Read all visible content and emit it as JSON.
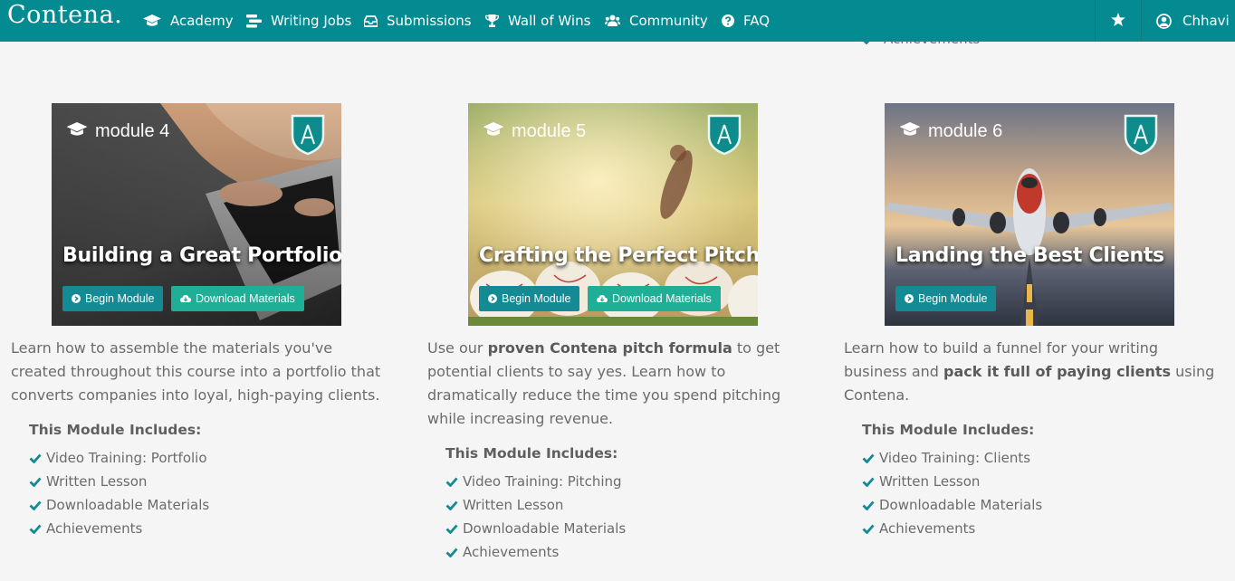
{
  "brand": "Contena.",
  "nav": {
    "items": [
      {
        "label": "Academy",
        "icon": "graduation-cap-icon"
      },
      {
        "label": "Writing Jobs",
        "icon": "jobs-icon"
      },
      {
        "label": "Submissions",
        "icon": "inbox-icon"
      },
      {
        "label": "Wall of Wins",
        "icon": "trophy-icon"
      },
      {
        "label": "Community",
        "icon": "users-icon"
      },
      {
        "label": "FAQ",
        "icon": "question-circle-icon"
      }
    ],
    "user": "Chhavi"
  },
  "peek_item": "Achievements",
  "colors": {
    "nav": "#048a91",
    "begin_button": "#138a94",
    "download_button": "#1fae96",
    "check": "#138a94"
  },
  "modules": [
    {
      "label": "module 4",
      "title": "Building a Great Portfolio",
      "begin": "Begin Module",
      "download": "Download Materials",
      "desc": [
        {
          "t": "Learn how to assemble the materials you've created throughout this course into a portfolio that converts companies into loyal, high-paying clients.",
          "b": false
        }
      ],
      "includes_title": "This Module Includes:",
      "includes": [
        "Video Training: Portfolio",
        "Written Lesson",
        "Downloadable Materials",
        "Achievements"
      ]
    },
    {
      "label": "module 5",
      "title": "Crafting the Perfect Pitch",
      "begin": "Begin Module",
      "download": "Download Materials",
      "desc": [
        {
          "t": "Use our ",
          "b": false
        },
        {
          "t": "proven Contena pitch formula",
          "b": true
        },
        {
          "t": " to get potential clients to say yes. Learn how to dramatically reduce the time you spend pitching while increasing revenue.",
          "b": false
        }
      ],
      "includes_title": "This Module Includes:",
      "includes": [
        "Video Training: Pitching",
        "Written Lesson",
        "Downloadable Materials",
        "Achievements"
      ]
    },
    {
      "label": "module 6",
      "title": "Landing the Best Clients",
      "begin": "Begin Module",
      "download": "",
      "desc": [
        {
          "t": "Learn how to build a funnel for your writing business and ",
          "b": false
        },
        {
          "t": "pack it full of paying clients",
          "b": true
        },
        {
          "t": " using Contena.",
          "b": false
        }
      ],
      "includes_title": "This Module Includes:",
      "includes": [
        "Video Training: Clients",
        "Written Lesson",
        "Downloadable Materials",
        "Achievements"
      ]
    }
  ]
}
